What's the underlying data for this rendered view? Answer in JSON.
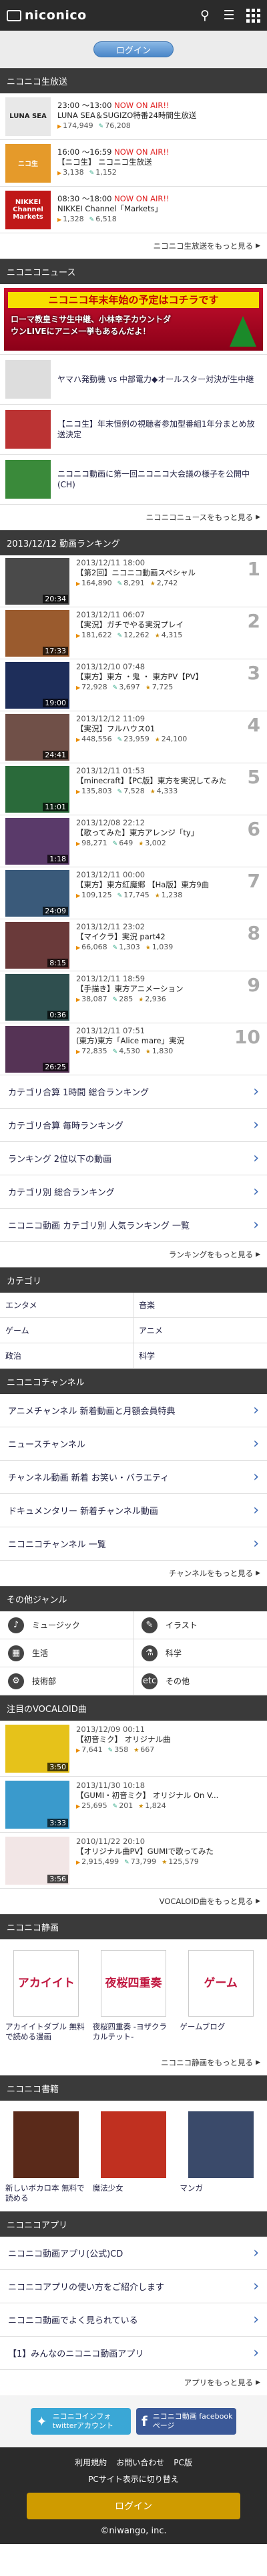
{
  "header": {
    "logo": "niconico",
    "login": "ログイン"
  },
  "live": {
    "title": "ニコニコ生放送",
    "items": [
      {
        "time": "23:00 ～13:00",
        "onair": "NOW ON AIR!!",
        "title": "LUNA SEA＆SUGIZO特番24時間生放送",
        "views": "174,949",
        "comments": "76,208",
        "mylist": "",
        "thumb": "LUNA SEA"
      },
      {
        "time": "16:00 ～16:59",
        "onair": "NOW ON AIR!!",
        "title": "【ニコ生】 ニコニコ生放送",
        "views": "3,138",
        "comments": "1,152",
        "mylist": "",
        "thumb": "ニコ生"
      },
      {
        "time": "08:30 ～18:00",
        "onair": "NOW ON AIR!!",
        "title": "NIKKEI Channel「Markets」",
        "views": "1,328",
        "comments": "6,518",
        "mylist": "",
        "thumb": "NIKKEI Channel Markets"
      }
    ],
    "more": "ニコニコ生放送をもっと見る"
  },
  "news": {
    "title": "ニコニコニュース",
    "bannerTitle": "ニコニコ年末年始の予定はコチラです",
    "bannerText": "ローマ教皇ミサ生中継、小林幸子カウントダウンLIVEにアニメ一挙もあるんだよ！",
    "items": [
      {
        "title": "ヤマハ発動機 vs 中部電力◆オールスター対決が生中継"
      },
      {
        "title": "【ニコ生】年末恒例の視聴者参加型番組1年分まとめ放送決定"
      },
      {
        "title": "ニコニコ動画に第一回ニコニコ大会議の様子を公開中(CH)"
      }
    ],
    "more": "ニコニコニュースをもっと見る"
  },
  "ranking": {
    "title": "2013/12/12 動画ランキング",
    "items": [
      {
        "date": "2013/12/11 18:00",
        "title": "【第2回】ニコニコ動画スペシャル",
        "views": "164,890",
        "comments": "8,291",
        "mylist": "2,742",
        "dur": "20:34",
        "num": "1"
      },
      {
        "date": "2013/12/11 06:07",
        "title": "【実況】ガチでやる実況プレイ",
        "views": "181,622",
        "comments": "12,262",
        "mylist": "4,315",
        "dur": "17:33",
        "num": "2"
      },
      {
        "date": "2013/12/10 07:48",
        "title": "【東方】東方 ・鬼 ・ 東方PV【PV】",
        "views": "72,928",
        "comments": "3,697",
        "mylist": "7,725",
        "dur": "19:00",
        "num": "3"
      },
      {
        "date": "2013/12/12 11:09",
        "title": "【実況】フルハウス01",
        "views": "448,556",
        "comments": "23,959",
        "mylist": "24,100",
        "dur": "24:41",
        "num": "4"
      },
      {
        "date": "2013/12/11 01:53",
        "title": "【minecraft】【PC版】東方を実況してみた",
        "views": "135,803",
        "comments": "7,528",
        "mylist": "4,333",
        "dur": "11:01",
        "num": "5"
      },
      {
        "date": "2013/12/08 22:12",
        "title": "【歌ってみた】東方アレンジ「ty」",
        "views": "98,271",
        "comments": "649",
        "mylist": "3,002",
        "dur": "1:18",
        "num": "6"
      },
      {
        "date": "2013/12/11 00:00",
        "title": "【東方】東方紅魔郷 【Ha版】東方9曲",
        "views": "109,125",
        "comments": "17,745",
        "mylist": "1,238",
        "dur": "24:09",
        "num": "7"
      },
      {
        "date": "2013/12/11 23:02",
        "title": "【マイクラ】実況 part42",
        "views": "66,068",
        "comments": "1,303",
        "mylist": "1,039",
        "dur": "8:15",
        "num": "8"
      },
      {
        "date": "2013/12/11 18:59",
        "title": "【手描き】東方アニメーション",
        "views": "38,087",
        "comments": "285",
        "mylist": "2,936",
        "dur": "0:36",
        "num": "9"
      },
      {
        "date": "2013/12/11 07:51",
        "title": "(東方)東方「Alice mare」実況",
        "views": "72,835",
        "comments": "4,530",
        "mylist": "1,830",
        "dur": "26:25",
        "num": "10"
      }
    ]
  },
  "nav": {
    "items": [
      {
        "label": "カテゴリ合算 1時間 総合ランキング"
      },
      {
        "label": "カテゴリ合算 毎時ランキング"
      },
      {
        "label": "ランキング 2位以下の動画"
      },
      {
        "label": "カテゴリ別 総合ランキング"
      },
      {
        "label": "ニコニコ動画 カテゴリ別 人気ランキング 一覧"
      }
    ],
    "more": "ランキングをもっと見る"
  },
  "categories": {
    "title": "カテゴリ",
    "items": [
      {
        "label": "エンタメ"
      },
      {
        "label": "音楽"
      },
      {
        "label": "ゲーム"
      },
      {
        "label": "アニメ"
      },
      {
        "label": "政治"
      },
      {
        "label": "科学"
      }
    ]
  },
  "nicochannel": {
    "title": "ニコニコチャンネル",
    "items": [
      {
        "label": "アニメチャンネル 新着動画と月額会員特典"
      },
      {
        "label": "ニュースチャンネル"
      },
      {
        "label": "チャンネル動画 新着 お笑い・バラエティ"
      },
      {
        "label": "ドキュメンタリー 新着チャンネル動画"
      },
      {
        "label": "ニコニコチャンネル 一覧"
      }
    ],
    "more": "チャンネルをもっと見る"
  },
  "genres": {
    "title": "その他ジャンル",
    "items": [
      {
        "icon": "♪",
        "label": "ミュージック"
      },
      {
        "icon": "✎",
        "label": "イラスト"
      },
      {
        "icon": "▦",
        "label": "生活"
      },
      {
        "icon": "⚗",
        "label": "科学"
      },
      {
        "icon": "⚙",
        "label": "技術部"
      },
      {
        "icon": "etc",
        "label": "その他"
      }
    ]
  },
  "vocaloid": {
    "title": "注目のVOCALOID曲",
    "items": [
      {
        "date": "2013/12/09 00:11",
        "title": "【初音ミク】 オリジナル曲",
        "views": "7,641",
        "comments": "358",
        "mylist": "667",
        "dur": "3:50"
      },
      {
        "date": "2013/11/30 10:18",
        "title": "【GUMI・初音ミク】 オリジナル On V...",
        "views": "25,695",
        "comments": "201",
        "mylist": "1,824",
        "dur": "3:33"
      },
      {
        "date": "2010/11/22 20:10",
        "title": "【オリジナル曲PV】GUMIで歌ってみた",
        "views": "2,915,499",
        "comments": "73,799",
        "mylist": "125,579",
        "dur": "3:56"
      }
    ],
    "more": "VOCALOID曲をもっと見る"
  },
  "manga": {
    "title": "ニコニコ静画",
    "items": [
      {
        "cover": "アカイイト",
        "label": "アカイイトダブル 無料で読める漫画"
      },
      {
        "cover": "夜桜四重奏",
        "label": "夜桜四重奏 -ヨザクラカルテット-"
      },
      {
        "cover": "ゲーム",
        "label": "ゲームブログ"
      }
    ],
    "more": "ニコニコ静画をもっと見る"
  },
  "books": {
    "title": "ニコニコ書籍",
    "items": [
      {
        "label": "新しいボカロ本 無料で読める"
      },
      {
        "label": "魔法少女"
      },
      {
        "label": "マンガ"
      }
    ]
  },
  "apps": {
    "title": "ニコニコアプリ",
    "items": [
      {
        "label": "ニコニコ動画アプリ(公式)CD"
      },
      {
        "label": "ニコニコアプリの使い方をご紹介します"
      },
      {
        "label": "ニコニコ動画でよく見られている"
      },
      {
        "label": "【1】みんなのニコニコ動画アプリ"
      }
    ],
    "more": "アプリをもっと見る"
  },
  "social": {
    "twitter": "ニコニコインフォ twitterアカウント",
    "facebook": "ニコニコ動画 facebookページ"
  },
  "footer": {
    "links": [
      "利用規約",
      "お問い合わせ",
      "PC版"
    ],
    "pcsite": "PCサイト表示に切り替え",
    "btn": "ログイン",
    "copy": "©niwango, inc."
  }
}
